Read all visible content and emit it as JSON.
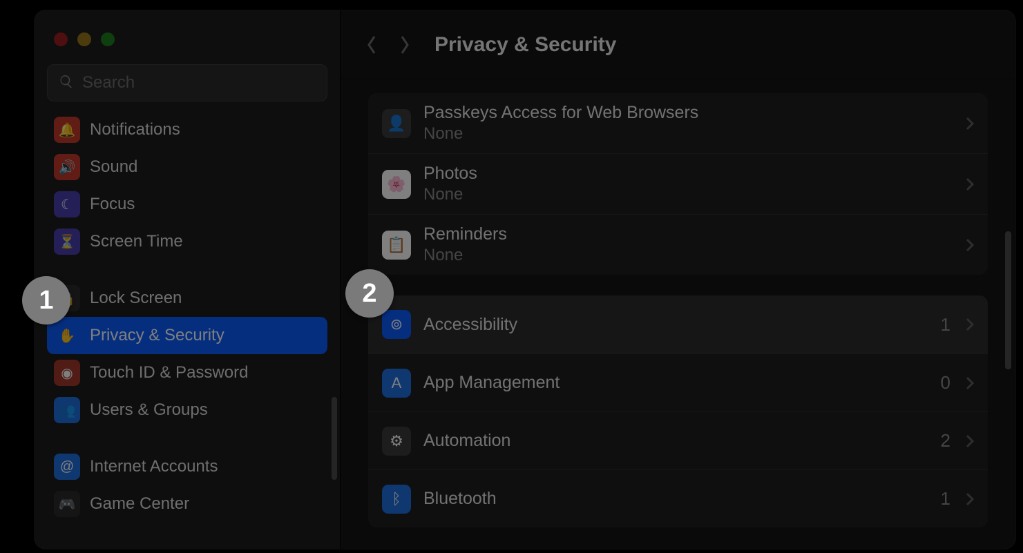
{
  "annotations": {
    "badge1": "1",
    "badge2": "2"
  },
  "search": {
    "placeholder": "Search"
  },
  "header": {
    "title": "Privacy & Security"
  },
  "sidebar": {
    "items": [
      {
        "label": "Notifications",
        "icon": "bell-icon",
        "bg": "#c0392b"
      },
      {
        "label": "Sound",
        "icon": "speaker-icon",
        "bg": "#c0392b"
      },
      {
        "label": "Focus",
        "icon": "moon-icon",
        "bg": "#4a3fb0"
      },
      {
        "label": "Screen Time",
        "icon": "hourglass-icon",
        "bg": "#4a3fb0"
      },
      {
        "spacer": true
      },
      {
        "label": "Lock Screen",
        "icon": "lock-icon",
        "bg": "#2b2b2d"
      },
      {
        "label": "Privacy & Security",
        "icon": "hand-icon",
        "bg": "#0a5dff",
        "selected": true
      },
      {
        "label": "Touch ID & Password",
        "icon": "fingerprint-icon",
        "bg": "#a0392b"
      },
      {
        "label": "Users & Groups",
        "icon": "users-icon",
        "bg": "#1f6fe0"
      },
      {
        "spacer": true
      },
      {
        "label": "Internet Accounts",
        "icon": "at-icon",
        "bg": "#1f6fe0"
      },
      {
        "label": "Game Center",
        "icon": "gamecenter-icon",
        "bg": "#2b2b2d"
      }
    ]
  },
  "main_groups": [
    {
      "rows": [
        {
          "title": "Passkeys Access for Web Browsers",
          "sub": "None",
          "icon": "passkey-icon",
          "bg": "#3a3a3c"
        },
        {
          "title": "Photos",
          "sub": "None",
          "icon": "photos-icon",
          "bg": "#ffffff"
        },
        {
          "title": "Reminders",
          "sub": "None",
          "icon": "reminders-icon",
          "bg": "#ffffff"
        }
      ]
    },
    {
      "rows": [
        {
          "title": "Accessibility",
          "count": "1",
          "icon": "accessibility-icon",
          "bg": "#0a5dff",
          "hover": true
        },
        {
          "title": "App Management",
          "count": "0",
          "icon": "appstore-icon",
          "bg": "#1f6fe0"
        },
        {
          "title": "Automation",
          "count": "2",
          "icon": "gears-icon",
          "bg": "#3a3a3c"
        },
        {
          "title": "Bluetooth",
          "count": "1",
          "icon": "bluetooth-icon",
          "bg": "#1f6fe0"
        }
      ]
    }
  ],
  "icon_glyphs": {
    "bell-icon": "🔔",
    "speaker-icon": "🔊",
    "moon-icon": "☾",
    "hourglass-icon": "⏳",
    "lock-icon": "🔒",
    "hand-icon": "✋",
    "fingerprint-icon": "◉",
    "users-icon": "👥",
    "at-icon": "@",
    "gamecenter-icon": "🎮",
    "passkey-icon": "👤",
    "photos-icon": "🌸",
    "reminders-icon": "📋",
    "accessibility-icon": "⊚",
    "appstore-icon": "A",
    "gears-icon": "⚙",
    "bluetooth-icon": "ᛒ"
  }
}
